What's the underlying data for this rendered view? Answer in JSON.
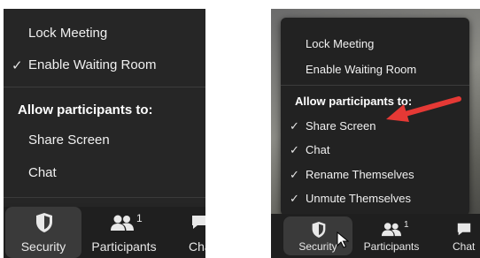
{
  "left_panel": {
    "menu": {
      "items": [
        {
          "label": "Lock Meeting",
          "checked": false
        },
        {
          "label": "Enable Waiting Room",
          "checked": true
        }
      ],
      "heading": "Allow participants to:",
      "permissions": [
        {
          "label": "Share Screen",
          "checked": false
        },
        {
          "label": "Chat",
          "checked": false
        }
      ]
    },
    "toolbar": {
      "security_label": "Security",
      "participants_label": "Participants",
      "participants_count": "1",
      "chat_label": "Cha"
    }
  },
  "right_panel": {
    "menu": {
      "items": [
        {
          "label": "Lock Meeting",
          "checked": false
        },
        {
          "label": "Enable Waiting Room",
          "checked": false
        }
      ],
      "heading": "Allow participants to:",
      "permissions": [
        {
          "label": "Share Screen",
          "checked": true
        },
        {
          "label": "Chat",
          "checked": true
        },
        {
          "label": "Rename Themselves",
          "checked": true
        },
        {
          "label": "Unmute Themselves",
          "checked": true
        }
      ]
    },
    "toolbar": {
      "security_label": "Security",
      "participants_label": "Participants",
      "participants_count": "1",
      "chat_label": "Chat"
    }
  },
  "icons": {
    "check": "✓",
    "shield": "shield-icon",
    "participants": "participants-icon",
    "chat": "chat-icon",
    "arrow": "red-arrow-annotation",
    "cursor": "mouse-pointer-icon"
  },
  "colors": {
    "menu_bg": "#222222",
    "toolbar_bg": "#1f1f1f",
    "active_button_bg": "#3a3a3a",
    "annotation_arrow": "#e53935"
  }
}
